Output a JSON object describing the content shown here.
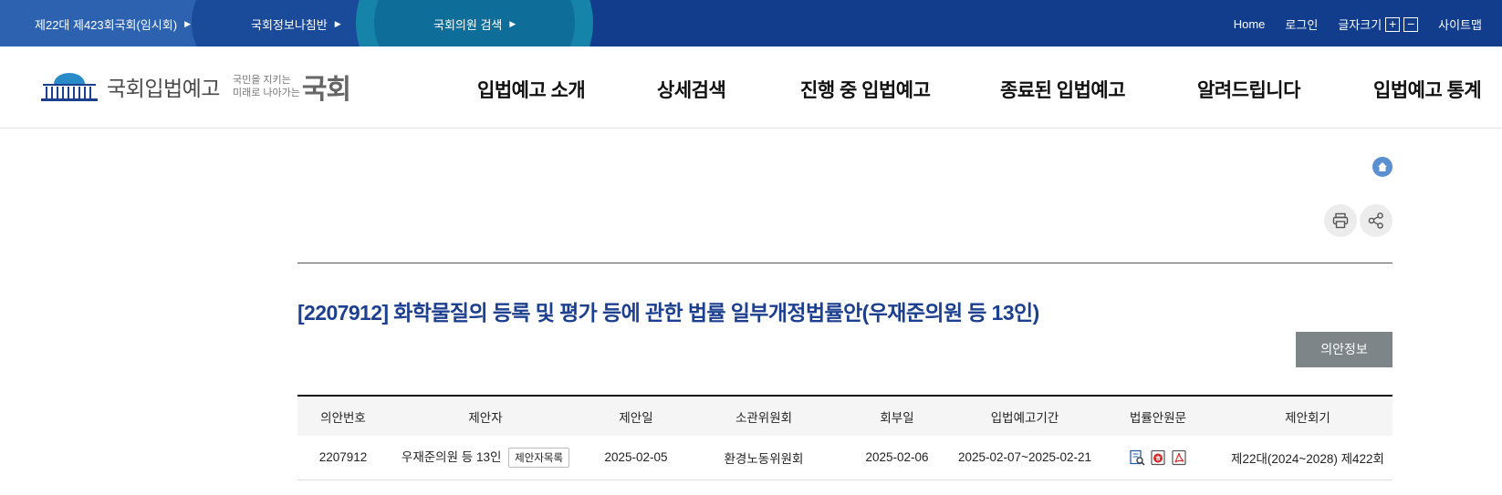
{
  "topbar": {
    "link1": "제22대 제423회국회(임시회)",
    "link2": "국회정보나침반",
    "link3": "국회의원 검색",
    "home": "Home",
    "login": "로그인",
    "fontsize_label": "글자크기",
    "font_plus": "+",
    "font_minus": "−",
    "sitemap": "사이트맵"
  },
  "header": {
    "logo_text": "국회입법예고",
    "logo_sub1": "국민을 지키는",
    "logo_sub2": "미래로 나아가는",
    "logo_big": "국회",
    "nav": [
      "입법예고 소개",
      "상세검색",
      "진행 중 입법예고",
      "종료된 입법예고",
      "알려드립니다",
      "입법예고 통계"
    ]
  },
  "icons": {
    "home": "home-icon",
    "print": "print-icon",
    "share": "share-icon"
  },
  "bill": {
    "title": "[2207912] 화학물질의 등록 및 평가 등에 관한 법률 일부개정법률안(우재준의원 등 13인)",
    "info_button": "의안정보"
  },
  "table": {
    "headers": [
      "의안번호",
      "제안자",
      "제안일",
      "소관위원회",
      "회부일",
      "입법예고기간",
      "법률안원문",
      "제안회기"
    ],
    "row": {
      "bill_no": "2207912",
      "proposer": "우재준의원 등 13인",
      "proposer_btn": "제안자목록",
      "proposed_date": "2025-02-05",
      "committee": "환경노동위원회",
      "referral_date": "2025-02-06",
      "period": "2025-02-07~2025-02-21",
      "session": "제22대(2024~2028) 제422회"
    }
  },
  "colors": {
    "topbar": "#123c8c",
    "title": "#1c3f8f",
    "info_button": "#7e8588"
  }
}
